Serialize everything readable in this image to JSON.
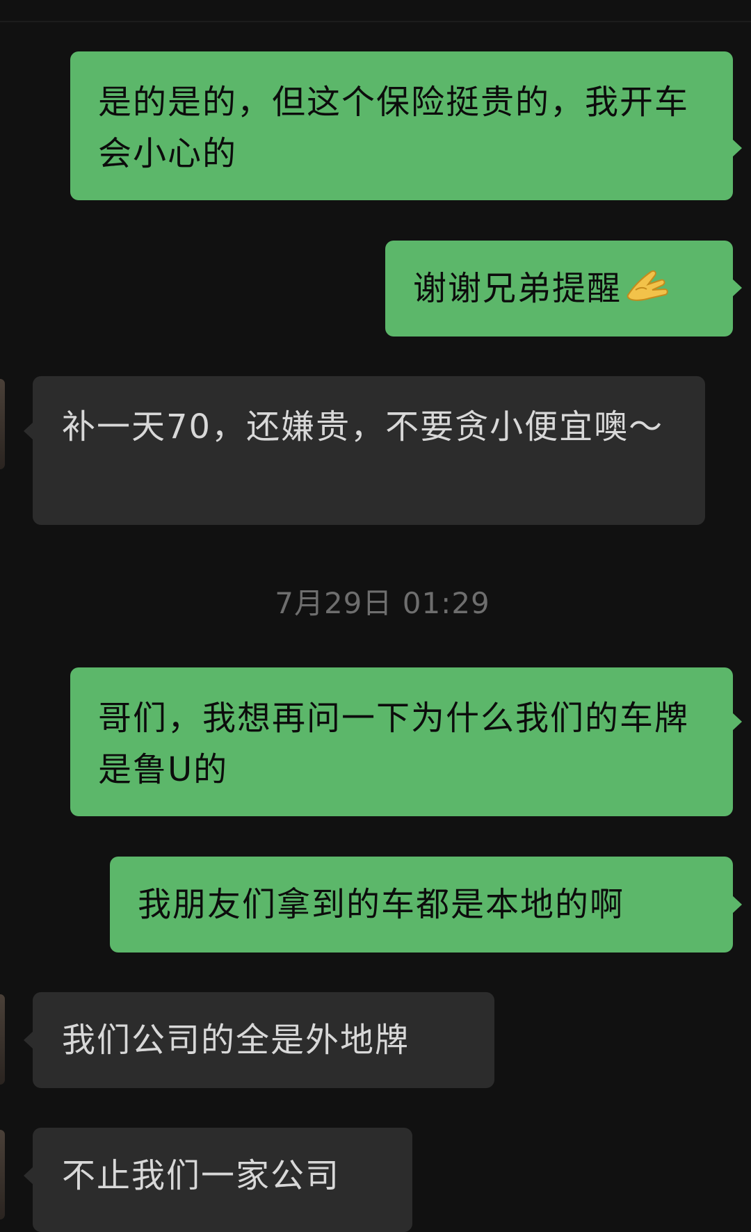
{
  "messages": [
    {
      "side": "sent",
      "text": "是的是的，但这个保险挺贵的，我开车会小心的"
    },
    {
      "side": "sent",
      "text": "谢谢兄弟提醒",
      "emoji": "pinching-hand-emoji"
    },
    {
      "side": "recv",
      "text": "补一天70，还嫌贵，不要贪小便宜噢～"
    },
    {
      "side": "sent",
      "text": "哥们，我想再问一下为什么我们的车牌是鲁U的"
    },
    {
      "side": "sent",
      "text": "我朋友们拿到的车都是本地的啊"
    },
    {
      "side": "recv",
      "text": "我们公司的全是外地牌"
    },
    {
      "side": "recv",
      "text": "不止我们一家公司"
    }
  ],
  "timestamp": "7月29日 01:29",
  "colors": {
    "background": "#111111",
    "sent_bubble": "#5cb76a",
    "recv_bubble": "#2c2c2c",
    "sent_text": "#0c0c0c",
    "recv_text": "#d8d8d8",
    "timestamp_text": "#6e6e6e"
  }
}
